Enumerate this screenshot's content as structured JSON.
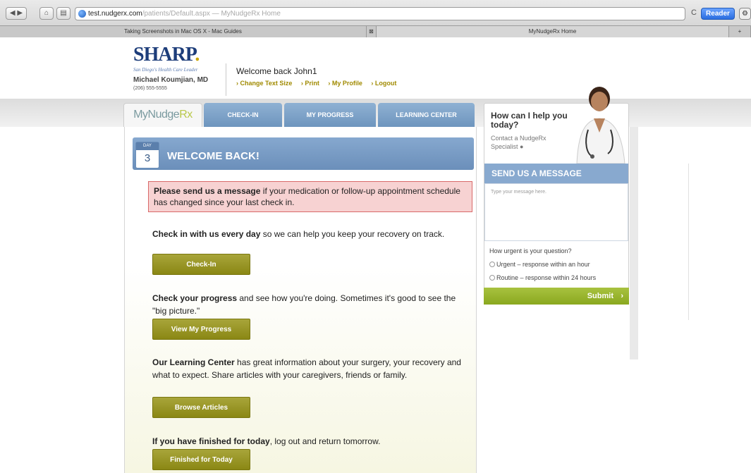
{
  "browser": {
    "url_host": "test.nudgerx.com",
    "url_path": "/patients/Default.aspx — MyNudgeRx Home",
    "reader_label": "Reader",
    "tabs": [
      {
        "label": "Taking Screenshots in Mac OS X - Mac Guides"
      },
      {
        "label": "MyNudgeRx Home"
      }
    ]
  },
  "header": {
    "logo_text": "SHARP",
    "logo_dot": ".",
    "tagline": "San Diego's Health Care Leader",
    "doctor": "Michael Koumjian, MD",
    "phone": "(206) 555-5555",
    "welcome": "Welcome back John1",
    "links": {
      "change_text_size": "› Change Text Size",
      "print": "› Print",
      "my_profile": "› My Profile",
      "logout": "› Logout"
    }
  },
  "tabs": {
    "home_prefix": "MyNudge",
    "home_suffix": "Rx",
    "checkin": "CHECK-IN",
    "progress": "MY PROGRESS",
    "learning": "LEARNING CENTER"
  },
  "main": {
    "day_label": "DAY",
    "day_number": "3",
    "welcome_title": "WELCOME BACK!",
    "alert_bold": "Please send us a message",
    "alert_rest": " if your medication or follow-up appointment schedule has changed since your last check in.",
    "checkin_bold": "Check in with us every day",
    "checkin_rest": " so we can help you keep your recovery on track.",
    "checkin_btn": "Check-In",
    "progress_bold": "Check your progress",
    "progress_rest": " and see how you're doing. Sometimes it's good to see the \"big picture.\"",
    "progress_btn": "View My Progress",
    "learning_bold": "Our Learning Center",
    "learning_rest": " has great information about your surgery, your recovery and what to expect. Share articles with your caregivers, friends or family.",
    "learning_btn": "Browse Articles",
    "finished_bold": "If you have finished for today",
    "finished_rest": ", log out and return tomorrow.",
    "finished_btn": "Finished for Today"
  },
  "sidebar": {
    "help_title": "How can I help you today?",
    "contact": "Contact a NudgeRx Specialist",
    "send_title": "SEND US A MESSAGE",
    "message_placeholder": "Type your message here.",
    "urgency_question": "How urgent is your question?",
    "option_urgent": "Urgent – response within an hour",
    "option_routine": "Routine – response within 24 hours",
    "submit": "Submit"
  },
  "colors": {
    "tab_blue": "#7a9fc7",
    "button_olive": "#9a9726",
    "alert_bg": "#f7d2d2",
    "submit_green": "#97b42c"
  }
}
